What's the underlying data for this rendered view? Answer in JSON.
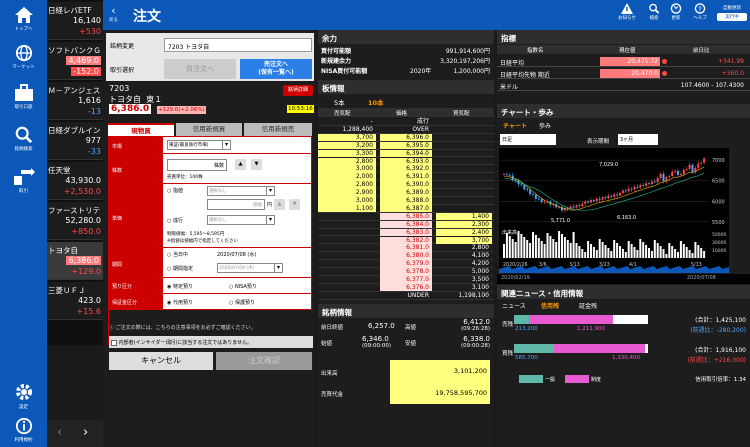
{
  "nav": [
    {
      "label": "トップへ",
      "icon": "home-icon"
    },
    {
      "label": "マーケット",
      "icon": "globe-icon"
    },
    {
      "label": "取引口座",
      "icon": "briefcase-icon"
    },
    {
      "label": "銘柄検索",
      "icon": "search-icon"
    },
    {
      "label": "取引",
      "icon": "trade-icon"
    },
    {
      "label": "設定",
      "icon": "gear-icon"
    },
    {
      "label": "利用規約",
      "icon": "info-icon"
    }
  ],
  "watchlist": [
    {
      "name": "日経レバETF",
      "price": "16,140",
      "change": "+530",
      "dir": "up"
    },
    {
      "name": "ソフトバンクＧ",
      "price": "4,469.0",
      "change": "-152.0",
      "dir": "down",
      "pricebox": true
    },
    {
      "name": "Ｍ－アンジェス",
      "price": "1,616",
      "change": "-13",
      "dir": "down2"
    },
    {
      "name": "日経ダブルイン",
      "price": "977",
      "change": "-33",
      "dir": "down2"
    },
    {
      "name": "任天堂",
      "price": "43,930.0",
      "change": "+2,530.0",
      "dir": "up"
    },
    {
      "name": "ファーストリテ",
      "price": "52,280.0",
      "change": "+850.0",
      "dir": "up"
    },
    {
      "name": "トヨタ自",
      "price": "6,386.0",
      "change": "+129.0",
      "dir": "up",
      "pricebox": true,
      "selected": true
    },
    {
      "name": "三菱ＵＦＪ",
      "price": "423.0",
      "change": "+15.6",
      "dir": "up"
    }
  ],
  "header": {
    "title": "注文",
    "back": "戻る",
    "icons": [
      "お知らせ",
      "検索",
      "更新",
      "ヘルプ"
    ],
    "right_label": "自動更新",
    "right_btn": "実行中"
  },
  "order": {
    "brand_change_label": "銘柄変更",
    "brand_value": "7203 トヨタ自",
    "trade_select_label": "取引選択",
    "btn_buy": "買注文へ",
    "btn_sell": "売注文へ\n(保有一覧へ)",
    "detail_btn": "銘柄詳細",
    "code": "7203",
    "name": "トヨタ自",
    "market": "東１",
    "price": "6,386.0",
    "change": "+129.0(+2.06%)",
    "time": "10:53:16",
    "tabs": [
      "現物買",
      "信用新規買",
      "信用新規売"
    ],
    "market_label": "市場",
    "market_value": "東証(最良執行市場)",
    "qty_label": "株数",
    "qty_unit": "株数",
    "trade_unit": "売買単位：100株",
    "price_label": "単価",
    "sashine": "指値",
    "sashine_sel": "選択なし",
    "nariyuki": "成行",
    "nariyuki_sel": "選択なし",
    "yen": "円",
    "tick_label": "値幅",
    "limit_text": "制限値幅：5,595～8,595円",
    "limit_note": "※指値は値幅内で指定してください",
    "period_label": "期間",
    "today": "当日中",
    "until": "期間指定",
    "today_date": "2020/07/08 (水)",
    "until_date": "2020/07/09 (木)",
    "acct_label": "預り区分",
    "acct_tokutei": "特定預り",
    "acct_nisa": "NISA預り",
    "margin_label": "保証金区分",
    "margin_daiyo": "代用預り",
    "margin_hogo": "保護預り",
    "notice1": "ご注文の際には、こちらの注意事項をお必ずご確認ください。",
    "notice2": "内部者(インサイダー)取引に該当する注文ではありません。",
    "cancel": "キャンセル",
    "confirm": "注文確認"
  },
  "balance": {
    "title": "余力",
    "rows": [
      {
        "label": "買付可能額",
        "value": "991,914,600円"
      },
      {
        "label": "新規建余力",
        "value": "3,320,197,206円"
      },
      {
        "label": "NISA買付可能額",
        "year": "2020年",
        "value": "1,200,000円"
      }
    ]
  },
  "board": {
    "title": "板情報",
    "tab5": "5本",
    "tab10": "10本",
    "h_sell": "売気配",
    "h_price": "価格",
    "h_buy": "買気配",
    "rows": [
      {
        "s": "-",
        "p": "成行",
        "b": ""
      },
      {
        "s": "1,288,400",
        "p": "OVER",
        "b": ""
      },
      {
        "s": "3,700",
        "p": "6,396.0",
        "b": ""
      },
      {
        "s": "3,200",
        "p": "6,395.0",
        "b": ""
      },
      {
        "s": "3,300",
        "p": "6,394.0",
        "b": ""
      },
      {
        "s": "2,800",
        "p": "6,393.0",
        "b": ""
      },
      {
        "s": "3,000",
        "p": "6,392.0",
        "b": ""
      },
      {
        "s": "2,000",
        "p": "6,391.0",
        "b": ""
      },
      {
        "s": "2,800",
        "p": "6,390.0",
        "b": ""
      },
      {
        "s": "2,900",
        "p": "6,389.0",
        "b": ""
      },
      {
        "s": "3,000",
        "p": "6,388.0",
        "b": ""
      },
      {
        "s": "1,100",
        "p": "6,387.0",
        "b": ""
      },
      {
        "s": "",
        "p": "6,385.0",
        "b": "1,400"
      },
      {
        "s": "",
        "p": "6,384.0",
        "b": "2,300"
      },
      {
        "s": "",
        "p": "6,383.0",
        "b": "2,400"
      },
      {
        "s": "",
        "p": "6,382.0",
        "b": "3,700"
      },
      {
        "s": "",
        "p": "6,381.0",
        "b": "2,800"
      },
      {
        "s": "",
        "p": "6,380.0",
        "b": "4,100"
      },
      {
        "s": "",
        "p": "6,379.0",
        "b": "4,200"
      },
      {
        "s": "",
        "p": "6,378.0",
        "b": "5,000"
      },
      {
        "s": "",
        "p": "6,377.0",
        "b": "3,500"
      },
      {
        "s": "",
        "p": "6,376.0",
        "b": "3,100"
      },
      {
        "s": "",
        "p": "UNDER",
        "b": "1,198,100"
      }
    ]
  },
  "info": {
    "title": "銘柄情報",
    "prev_label": "前日終値",
    "prev": "6,257.0",
    "high_label": "高値",
    "high": "6,412.0",
    "high_time": "(09:26:28)",
    "open_label": "始値",
    "open": "6,346.0",
    "open_time": "(09:00:00)",
    "low_label": "安値",
    "low": "6,338.0",
    "low_time": "(09:00:28)",
    "vol_label": "出来高",
    "vol": "3,101,200",
    "amt_label": "売買代金",
    "amt": "19,758,595,700"
  },
  "indices": {
    "title": "指標",
    "h_name": "指数名",
    "h_now": "現在値",
    "h_diff": "前日比",
    "rows": [
      {
        "name": "日経平均",
        "now": "20,475.72",
        "diff": "+341.99",
        "dot": true
      },
      {
        "name": "日経平均先物 期近",
        "now": "20,470.0",
        "diff": "+360.0",
        "dot": true
      },
      {
        "name": "米ドル",
        "now": "107.4600 - 107.4300",
        "diff": ""
      }
    ]
  },
  "chart": {
    "title": "チャート・歩み",
    "tab_chart": "チャート",
    "tab_ayumi": "歩み",
    "type_sel": "日足",
    "period_label": "表示期間",
    "period_sel": "3ヶ月",
    "label_high": "7,029.0",
    "label_low1": "5,771.0",
    "label_low2": "6,163.0",
    "vol_label": "出来高",
    "yticks": [
      "7000",
      "6500",
      "6000",
      "5500"
    ],
    "vticks": [
      "50000",
      "30000",
      "10000"
    ],
    "xticks": [
      "2020/2/26",
      "3/6",
      "3/13",
      "3/23",
      "4/1"
    ],
    "xticks2": [
      "5/13"
    ],
    "range_from": "2020/02/19",
    "range_to": "2020/07/08"
  },
  "news": {
    "title": "関連ニュース・信用情報",
    "tab_news": "ニュース",
    "tab_credit": "信用残",
    "tab_lending": "証金残",
    "sell_label": "売残",
    "sell_a": "213,200",
    "sell_b": "1,211,900",
    "sell_total_label": "(合計：1,425,100",
    "sell_diff": "(前週比：-280,200)",
    "buy_label": "買残",
    "buy_a": "585,700",
    "buy_b": "1,330,400",
    "buy_total_label": "(合計：1,916,100",
    "buy_diff": "(前週比：+216,000)",
    "legend_ippan": "一般",
    "legend_seido": "制度",
    "ratio": "信用取引倍率：1.34"
  },
  "colors": {
    "accent": "#0b58b8",
    "up": "#ff4a4a",
    "down": "#4aa8ff",
    "yellow": "#ffff7f"
  }
}
